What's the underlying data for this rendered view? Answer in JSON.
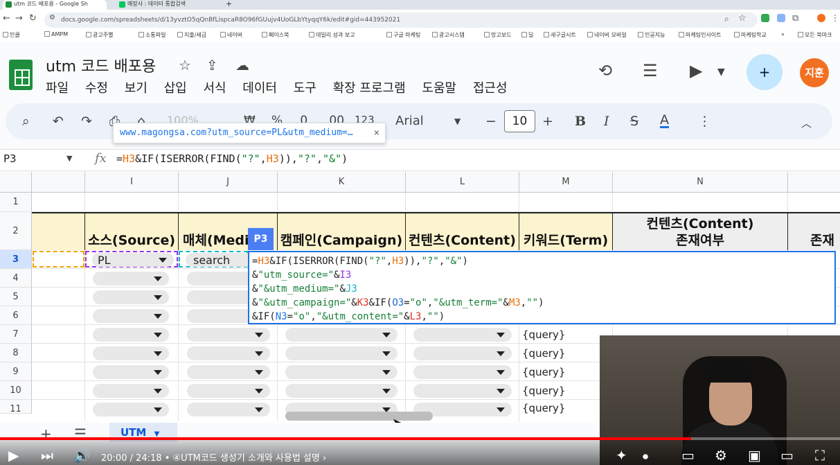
{
  "browser": {
    "tabs": [
      "utm 코드 배포용 - Google Sh",
      "매장사 : 데이터 통합검색"
    ],
    "new_tab": "+",
    "url": "docs.google.com/spreadsheets/d/13yvztO5qQnBfLispcaR8O96fGUujv4UoGLbYtyqqY6k/edit#gid=443952021",
    "bookmarks": [
      "인쿨",
      "AMPM",
      "광고주별",
      "소통파일",
      "지출/세금",
      "네이버",
      "페이스북",
      "데일리 성과 보고",
      "구글 마케팅",
      "광고시스템",
      "망고보드",
      "딜",
      "새구글시트",
      "네이버 모바일",
      "인공지능",
      "마케팅인사이트",
      "마케팅학교",
      "모든 북마크"
    ]
  },
  "sheets": {
    "title": "utm 코드 배포용",
    "menu": [
      "파일",
      "수정",
      "보기",
      "삽입",
      "서식",
      "데이터",
      "도구",
      "확장 프로그램",
      "도움말",
      "접근성"
    ],
    "avatar": "지훈",
    "toolbar": {
      "font": "Arial",
      "font_size": "10",
      "zoom": "100%",
      "currency": "₩",
      "percent": "%",
      "dec_dec": ".0",
      "dec_inc": ".00",
      "num_fmt": "123"
    },
    "tooltip_url": "www.magongsa.com?utm_source=PL&utm_medium=…"
  },
  "formula_bar": {
    "cell_ref": "P3",
    "fx": "fx"
  },
  "grid": {
    "columns": [
      "I",
      "J",
      "K",
      "L",
      "M",
      "N"
    ],
    "rows": [
      "1",
      "2",
      "3",
      "4",
      "5",
      "6",
      "7",
      "8",
      "9",
      "10",
      "11"
    ],
    "headers": {
      "I": "소스(Source)",
      "J": "매체(Medi",
      "K": "캠페인(Campaign)",
      "L": "컨텐츠(Content)",
      "M": "키워드(Term)",
      "N1": "컨텐츠(Content)",
      "N2": "존재여부",
      "O": "존재"
    },
    "row3": {
      "source": "PL",
      "medium": "search"
    },
    "query_values": [
      "{query}",
      "{query}",
      "{query}",
      "{query}",
      "{query}"
    ]
  },
  "editor": {
    "tag": "P3"
  },
  "sheet_tab": "UTM",
  "player": {
    "time": "20:00 / 24:18",
    "chapter": "• ④UTM코드 생성기 소개와 사용법 설명",
    "progress": 0.823
  }
}
